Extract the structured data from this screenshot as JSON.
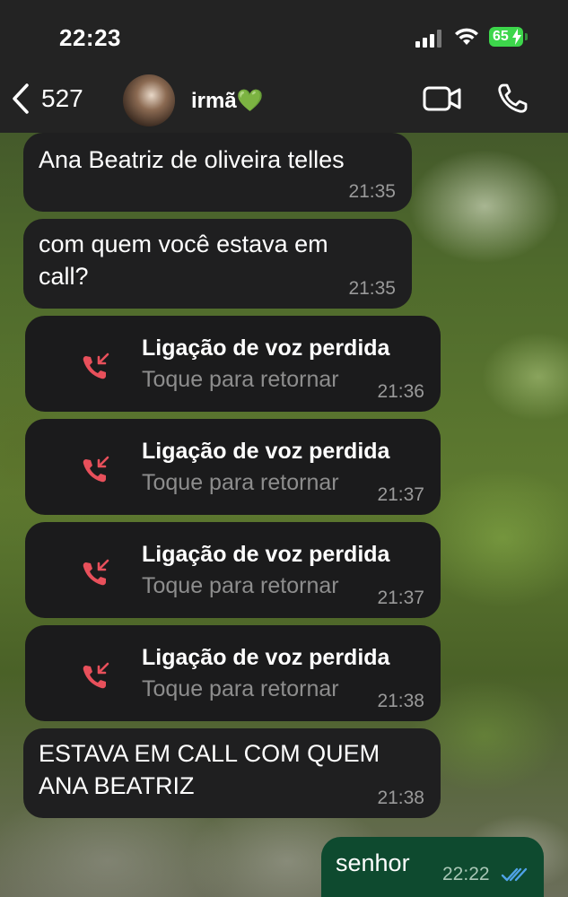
{
  "status_bar": {
    "time": "22:23",
    "battery": "65"
  },
  "header": {
    "back_count": "527",
    "contact_name": "irmã💚"
  },
  "messages": [
    {
      "text": "Ana Beatriz de oliveira telles",
      "time": "21:35"
    },
    {
      "text": "com quem você estava em call?",
      "time": "21:35"
    },
    {
      "title": "Ligação de voz perdida",
      "subtitle": "Toque para retornar",
      "time": "21:36"
    },
    {
      "title": "Ligação de voz perdida",
      "subtitle": "Toque para retornar",
      "time": "21:37"
    },
    {
      "title": "Ligação de voz perdida",
      "subtitle": "Toque para retornar",
      "time": "21:37"
    },
    {
      "title": "Ligação de voz perdida",
      "subtitle": "Toque para retornar",
      "time": "21:38"
    },
    {
      "text": "ESTAVA EM CALL COM QUEM ANA BEATRIZ",
      "time": "21:38"
    },
    {
      "text": "senhor",
      "time": "22:22",
      "status": "read"
    }
  ],
  "colors": {
    "incoming_bubble": "#1f1f20",
    "outgoing_bubble": "#0e4a2f",
    "missed_call": "#e8505b",
    "read_ticks": "#4fa3e8",
    "battery": "#3dd64b"
  },
  "icons": [
    "chevron-left-icon",
    "video-camera-icon",
    "phone-icon",
    "missed-call-icon",
    "double-check-icon",
    "signal-icon",
    "wifi-icon",
    "bolt-icon"
  ]
}
